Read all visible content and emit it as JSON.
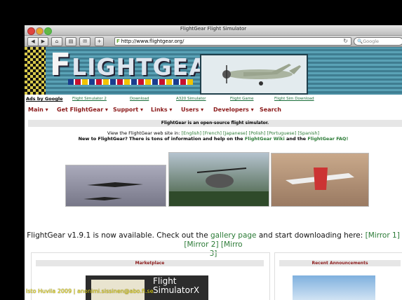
{
  "window": {
    "title": "FlightGear Flight Simulator",
    "url": "http://www.flightgear.org/",
    "search_placeholder": "Google"
  },
  "banner": {
    "logo_first": "F",
    "logo_rest": "LIGHTGEAR"
  },
  "ads": {
    "label": "Ads by Google",
    "links": [
      "Flight Simulator 2",
      "Download",
      "A320 Simulator",
      "Flight Game",
      "Flight Sim Download"
    ]
  },
  "nav": [
    "Main",
    "Get FlightGear",
    "Support",
    "Links",
    "Users",
    "Developers",
    "Search"
  ],
  "tagline": "FlightGear is an open-source flight simulator.",
  "languages": {
    "prefix": "View the FlightGear web site in:",
    "items": [
      "[English]",
      "[French]",
      "[Japanese]",
      "[Polish]",
      "[Portuguese]",
      "[Spanish]"
    ],
    "line2_a": "New to FlightGear? There is tons of information and help on the",
    "wiki": "FlightGear Wiki",
    "and": "and the",
    "faq": "FlightGear FAQ!"
  },
  "announcement": {
    "a": "FlightGear v1.9.1 is now available. Check out the",
    "gallery": "gallery page",
    "b": "and start downloading here:",
    "m1": "[Mirror 1]",
    "m2": "[Mirror 2]",
    "m3a": "[Mirro",
    "m3b": "3]"
  },
  "boxes": {
    "left": "Marketplace",
    "right": "Recent Announcements"
  },
  "fsx": {
    "line1": "Flight",
    "line2": "SimulatorX"
  },
  "credit": "Isto Huvila 2009 | anonimi.sissinen@abo.fi.se",
  "colors": {
    "nav": "#8b1a1a",
    "link": "#2a7a35",
    "banner": "#4a8fa3"
  }
}
